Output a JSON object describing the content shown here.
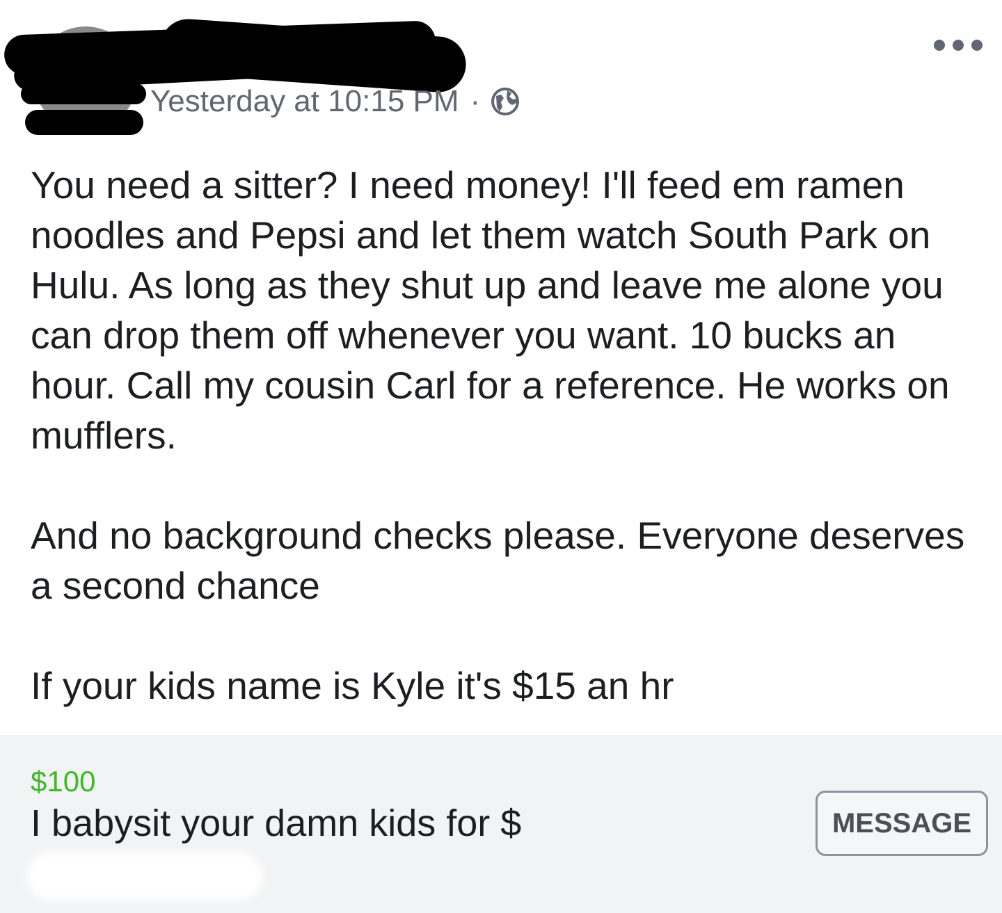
{
  "header": {
    "timestamp": "Yesterday at 10:15 PM",
    "separator": "·",
    "privacy_icon": "globe-icon",
    "more_icon": "more-horizontal-icon"
  },
  "body": {
    "paragraphs": [
      "You need a sitter? I need money! I'll feed em ramen noodles and Pepsi and let them watch South Park on Hulu. As long as they shut up and leave me alone you can drop them off whenever you want. 10 bucks an hour. Call my cousin Carl for a reference. He works on mufflers.",
      " And no background checks please. Everyone deserves a second chance",
      "If your kids name is Kyle it's $15 an hr"
    ]
  },
  "listing": {
    "price": "$100",
    "title": "I babysit your damn kids for $",
    "message_button": "MESSAGE"
  },
  "colors": {
    "price_green": "#42b72a",
    "text": "#1c1e21",
    "meta_gray": "#606770",
    "listing_bg": "#f2f3f5"
  }
}
